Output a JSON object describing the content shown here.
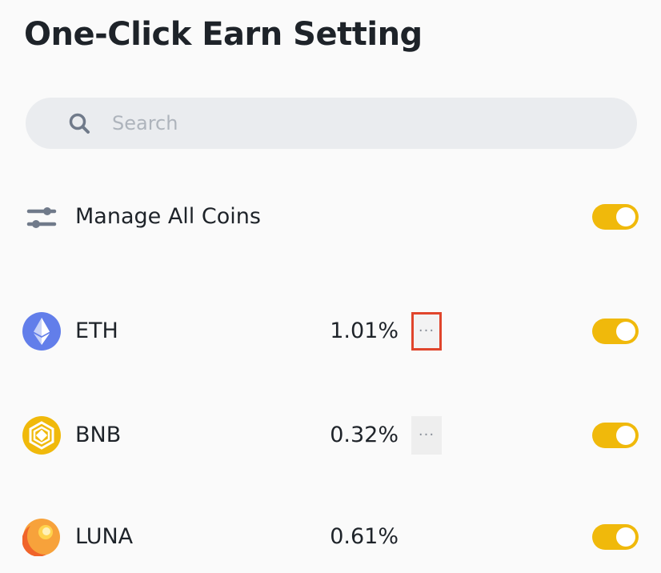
{
  "page": {
    "title": "One-Click Earn Setting"
  },
  "search": {
    "placeholder": "Search",
    "value": "",
    "icon": "search-icon"
  },
  "manage_all": {
    "label": "Manage All Coins",
    "icon": "sliders-icon",
    "toggle_on": true
  },
  "coins": [
    {
      "symbol": "ETH",
      "rate": "1.01%",
      "icon": "eth-icon",
      "has_more": true,
      "more_highlighted": true,
      "more_label": "···",
      "toggle_on": true
    },
    {
      "symbol": "BNB",
      "rate": "0.32%",
      "icon": "bnb-icon",
      "has_more": true,
      "more_highlighted": false,
      "more_label": "···",
      "toggle_on": true
    },
    {
      "symbol": "LUNA",
      "rate": "0.61%",
      "icon": "luna-icon",
      "has_more": false,
      "toggle_on": true
    }
  ],
  "colors": {
    "toggle_on": "#f0b90b",
    "highlight_border": "#e0452c",
    "eth": "#627eea",
    "bnb": "#f0b90b",
    "luna": "#f0642a"
  }
}
